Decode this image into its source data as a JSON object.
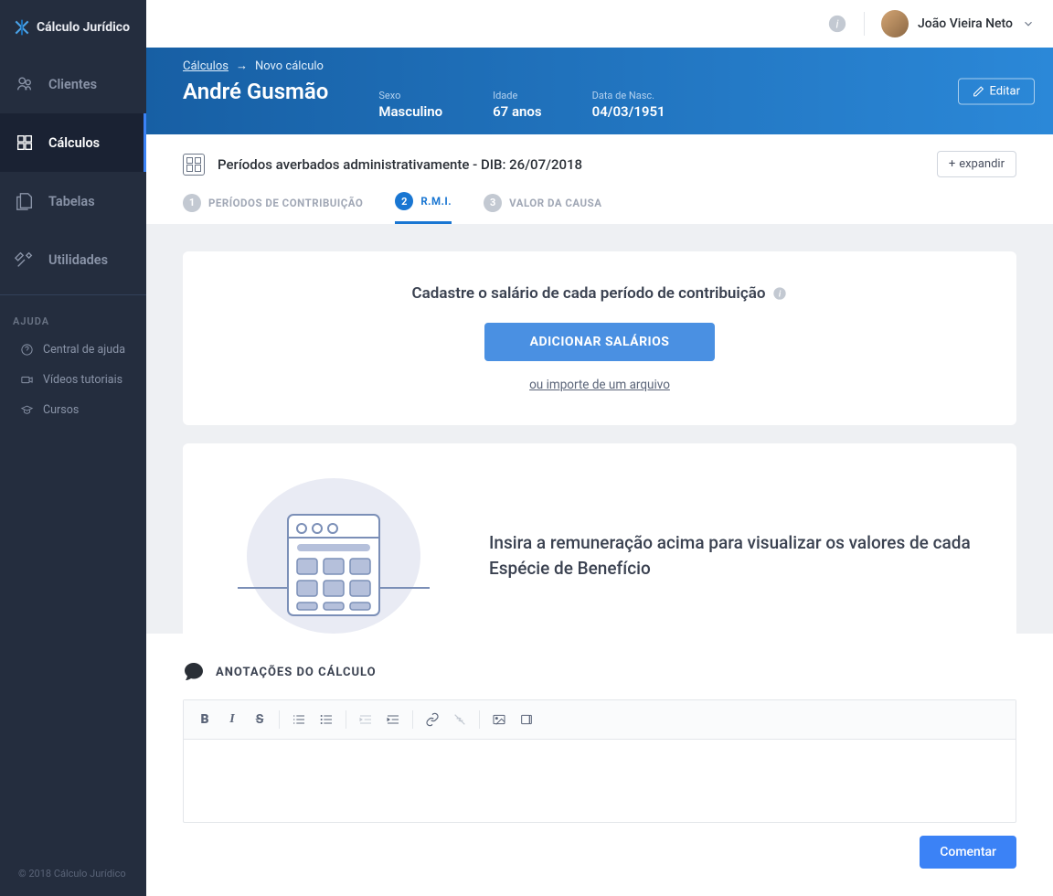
{
  "brand": "Cálculo Jurídico",
  "sidebar": {
    "items": [
      {
        "label": "Clientes"
      },
      {
        "label": "Cálculos"
      },
      {
        "label": "Tabelas"
      },
      {
        "label": "Utilidades"
      }
    ],
    "help": {
      "title": "AJUDA",
      "items": [
        {
          "label": "Central de ajuda"
        },
        {
          "label": "Vídeos tutoriais"
        },
        {
          "label": "Cursos"
        }
      ]
    },
    "copyright": "© 2018 Cálculo Jurídico"
  },
  "user": {
    "name": "João Vieira Neto"
  },
  "breadcrumb": {
    "root": "Cálculos",
    "current": "Novo cálculo"
  },
  "header": {
    "client_name": "André Gusmão",
    "meta": [
      {
        "label": "Sexo",
        "value": "Masculino"
      },
      {
        "label": "Idade",
        "value": "67 anos"
      },
      {
        "label": "Data de Nasc.",
        "value": "04/03/1951"
      }
    ],
    "edit_label": "Editar"
  },
  "sub_header": {
    "title": "Períodos averbados administrativamente - DIB: 26/07/2018",
    "expand_label": "expandir"
  },
  "steps": [
    {
      "num": "1",
      "label": "PERÍODOS DE CONTRIBUIÇÃO"
    },
    {
      "num": "2",
      "label": "R.M.I."
    },
    {
      "num": "3",
      "label": "VALOR DA CAUSA"
    }
  ],
  "salary_card": {
    "title": "Cadastre o salário de cada período de contribuição",
    "button": "ADICIONAR SALÁRIOS",
    "import_link": "ou importe de um arquivo"
  },
  "placeholder_card": {
    "text": "Insira a remuneração acima para visualizar os valores de cada Espécie de Benefício"
  },
  "annotations": {
    "title": "ANOTAÇÕES DO CÁLCULO",
    "comment_button": "Comentar"
  }
}
